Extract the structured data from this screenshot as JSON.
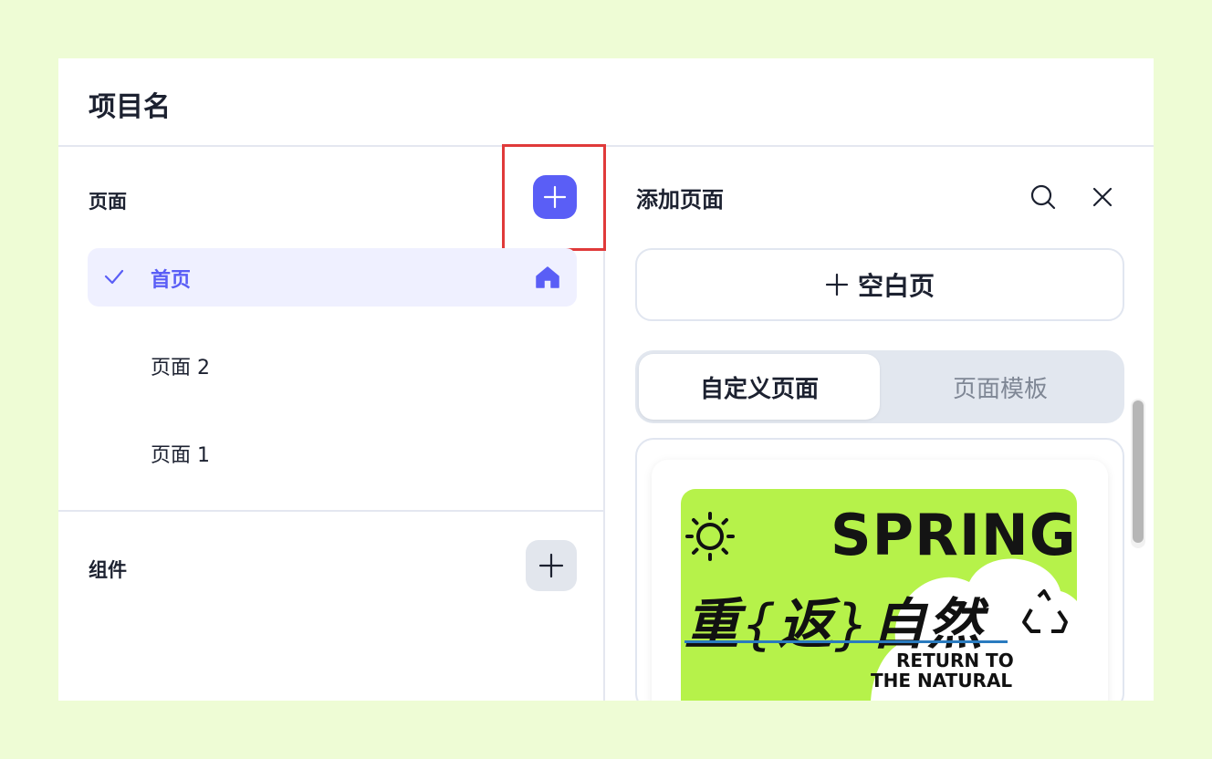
{
  "header": {
    "title": "项目名"
  },
  "pages_section": {
    "title": "页面",
    "items": [
      {
        "label": "首页",
        "active": true,
        "is_home": true
      },
      {
        "label": "页面 2",
        "active": false
      },
      {
        "label": "页面 1",
        "active": false
      }
    ]
  },
  "components_section": {
    "title": "组件"
  },
  "add_page_panel": {
    "title": "添加页面",
    "blank_page_label": "空白页",
    "tabs": [
      {
        "label": "自定义页面",
        "active": true
      },
      {
        "label": "页面模板",
        "active": false
      }
    ],
    "template_preview": {
      "headline_en": "SPRING",
      "headline_cn_1": "重",
      "headline_cn_bracket_open": "{",
      "headline_cn_2": "返",
      "headline_cn_bracket_close": "}",
      "headline_cn_3": "自然",
      "tagline_line1": "RETURN TO",
      "tagline_line2": "THE NATURAL"
    }
  },
  "colors": {
    "accent": "#5a5ef6",
    "background": "#eefcd5",
    "highlight_box": "#e03a3a",
    "template_green": "#b6f24a"
  }
}
